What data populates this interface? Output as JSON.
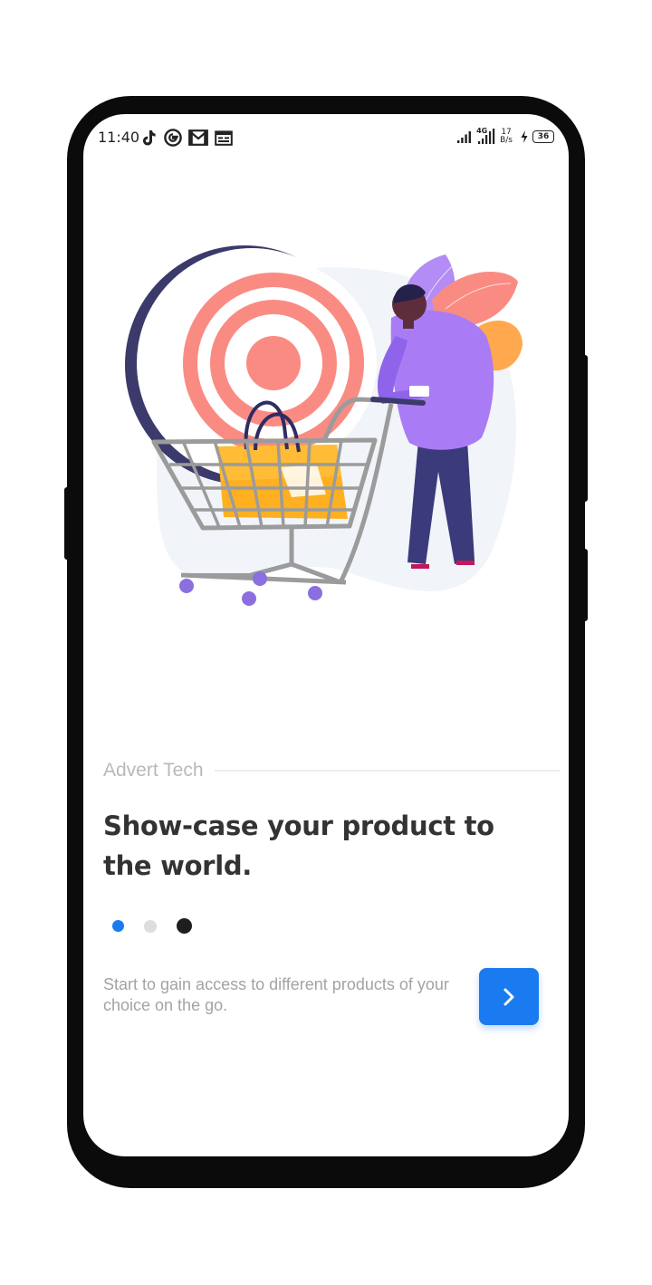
{
  "status_bar": {
    "time": "11:40",
    "network": "4G",
    "speed_value": "17",
    "speed_unit": "B/s",
    "battery": "36",
    "left_icons": [
      "tiktok-icon",
      "google-icon",
      "gmail-icon",
      "calendar-icon"
    ],
    "right_icons": [
      "signal-icon",
      "signal-4g-icon",
      "charging-icon",
      "battery-icon"
    ]
  },
  "onboarding": {
    "brand": "Advert Tech",
    "headline": "Show-case your product to the world.",
    "description": "Start to gain access to different products of your choice on the go.",
    "next_icon": "chevron-right-icon",
    "page_indicator": {
      "total": 3,
      "active_index": 0
    }
  },
  "colors": {
    "accent": "#1a7bf0",
    "headline": "#333333",
    "brand": "#b9b9bd",
    "description": "#a3a3a8",
    "dot_active": "#1a7bf0",
    "dot_inactive": "#dddddf",
    "dot_dark": "#1e1e1e"
  }
}
